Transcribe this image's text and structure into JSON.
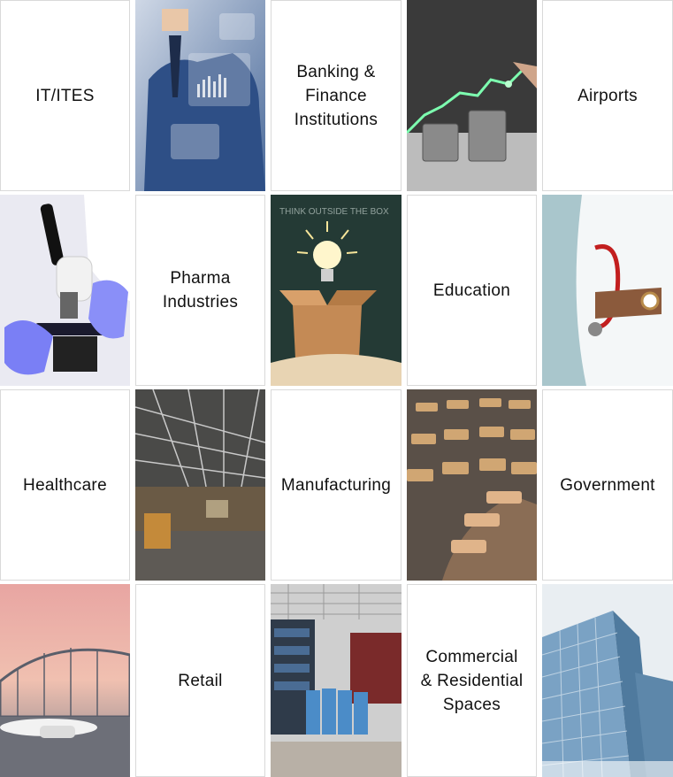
{
  "tiles": [
    {
      "kind": "text",
      "label": "IT/ITES"
    },
    {
      "kind": "image",
      "icon": "business-tech-photo"
    },
    {
      "kind": "text",
      "label": "Banking &\nFinance\nInstitutions"
    },
    {
      "kind": "image",
      "icon": "coins-growth-photo"
    },
    {
      "kind": "text",
      "label": "Airports"
    },
    {
      "kind": "image",
      "icon": "microscope-photo"
    },
    {
      "kind": "text",
      "label": "Pharma\nIndustries"
    },
    {
      "kind": "image",
      "icon": "lightbulb-box-photo"
    },
    {
      "kind": "text",
      "label": "Education"
    },
    {
      "kind": "image",
      "icon": "doctor-stethoscope-photo"
    },
    {
      "kind": "text",
      "label": "Healthcare"
    },
    {
      "kind": "image",
      "icon": "factory-warehouse-photo"
    },
    {
      "kind": "text",
      "label": "Manufacturing"
    },
    {
      "kind": "image",
      "icon": "parliament-chamber-photo"
    },
    {
      "kind": "text",
      "label": "Government"
    },
    {
      "kind": "image",
      "icon": "airport-airplane-photo"
    },
    {
      "kind": "text",
      "label": "Retail"
    },
    {
      "kind": "image",
      "icon": "clothing-store-photo"
    },
    {
      "kind": "text",
      "label": "Commercial\n& Residential\nSpaces"
    },
    {
      "kind": "image",
      "icon": "office-building-photo"
    }
  ]
}
